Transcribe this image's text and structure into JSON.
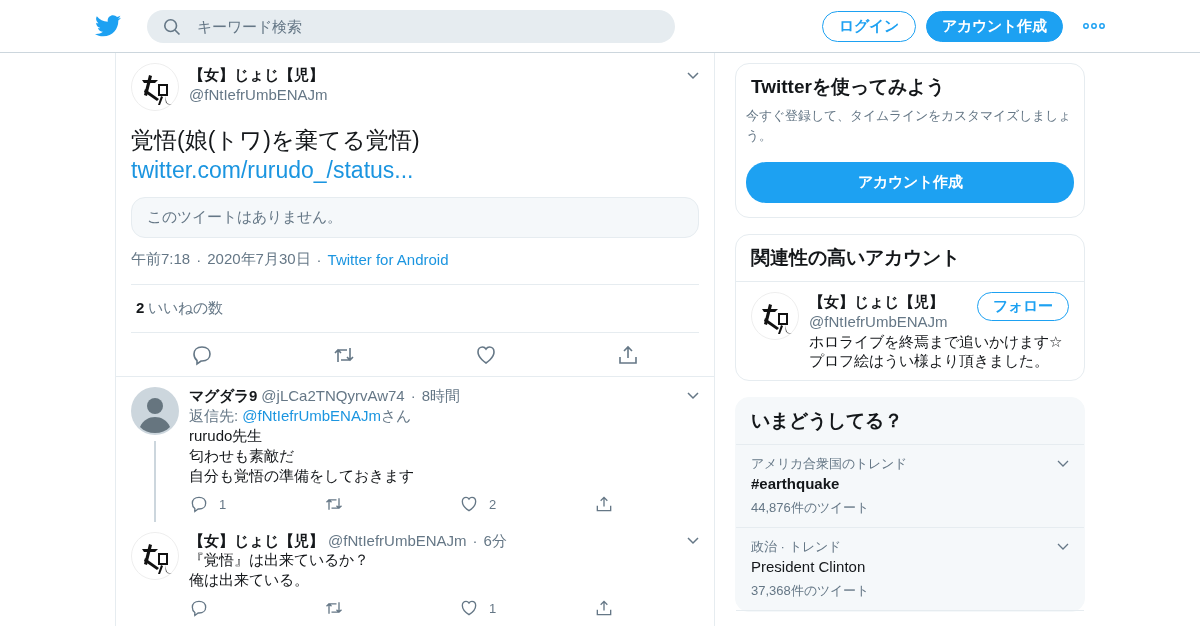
{
  "header": {
    "search_placeholder": "キーワード検索",
    "login": "ログイン",
    "signup": "アカウント作成"
  },
  "main_tweet": {
    "name": "【女】じょじ【児】",
    "handle": "@fNtIefrUmbENAJm",
    "text": "覚悟(娘(トワ)を棄てる覚悟)",
    "link": "twitter.com/rurudo_/status...",
    "quoted": "このツイートはありません。",
    "time": "午前7:18",
    "date": "2020年7月30日",
    "source": "Twitter for Android",
    "separator": "·",
    "likes_count": "2",
    "likes_label": "いいねの数"
  },
  "replies": [
    {
      "kind": "default",
      "thread": true,
      "name": "マグダラ9",
      "handle": "@jLCa2TNQyrvAw74",
      "separator": "·",
      "time": "8時間",
      "reply_prefix": "返信先: ",
      "reply_handle": "@fNtIefrUmbENAJm",
      "reply_suffix": "さん",
      "lines": [
        "rurudo先生",
        "匂わせも素敵だ",
        "自分も覚悟の準備をしておきます"
      ],
      "counts": {
        "reply": "1",
        "like": "2"
      }
    },
    {
      "kind": "picture",
      "thread": false,
      "name": "【女】じょじ【児】",
      "handle": "@fNtIefrUmbENAJm",
      "separator": "·",
      "time": "6分",
      "lines": [
        "『覚悟』は出来ているか？",
        "俺は出来ている。"
      ],
      "counts": {
        "like": "1"
      }
    }
  ],
  "signup_card": {
    "title": "Twitterを使ってみよう",
    "text": "今すぐ登録して、タイムラインをカスタマイズしましょう。",
    "button": "アカウント作成"
  },
  "related": {
    "title": "関連性の高いアカウント",
    "accounts": [
      {
        "name": "【女】じょじ【児】",
        "handle": "@fNtIefrUmbENAJm",
        "follow": "フォロー",
        "bio": [
          "ホロライブを終焉まで追いかけます☆",
          "プロフ絵はうい様より頂きました。"
        ]
      }
    ]
  },
  "trends": {
    "title": "いまどうしてる？",
    "items": [
      {
        "context": "アメリカ合衆国のトレンド",
        "name": "#earthquake",
        "bold": true,
        "count": "44,876件のツイート"
      },
      {
        "context": "政治 · トレンド",
        "name": "President Clinton",
        "bold": false,
        "count": "37,368件のツイート"
      }
    ]
  }
}
